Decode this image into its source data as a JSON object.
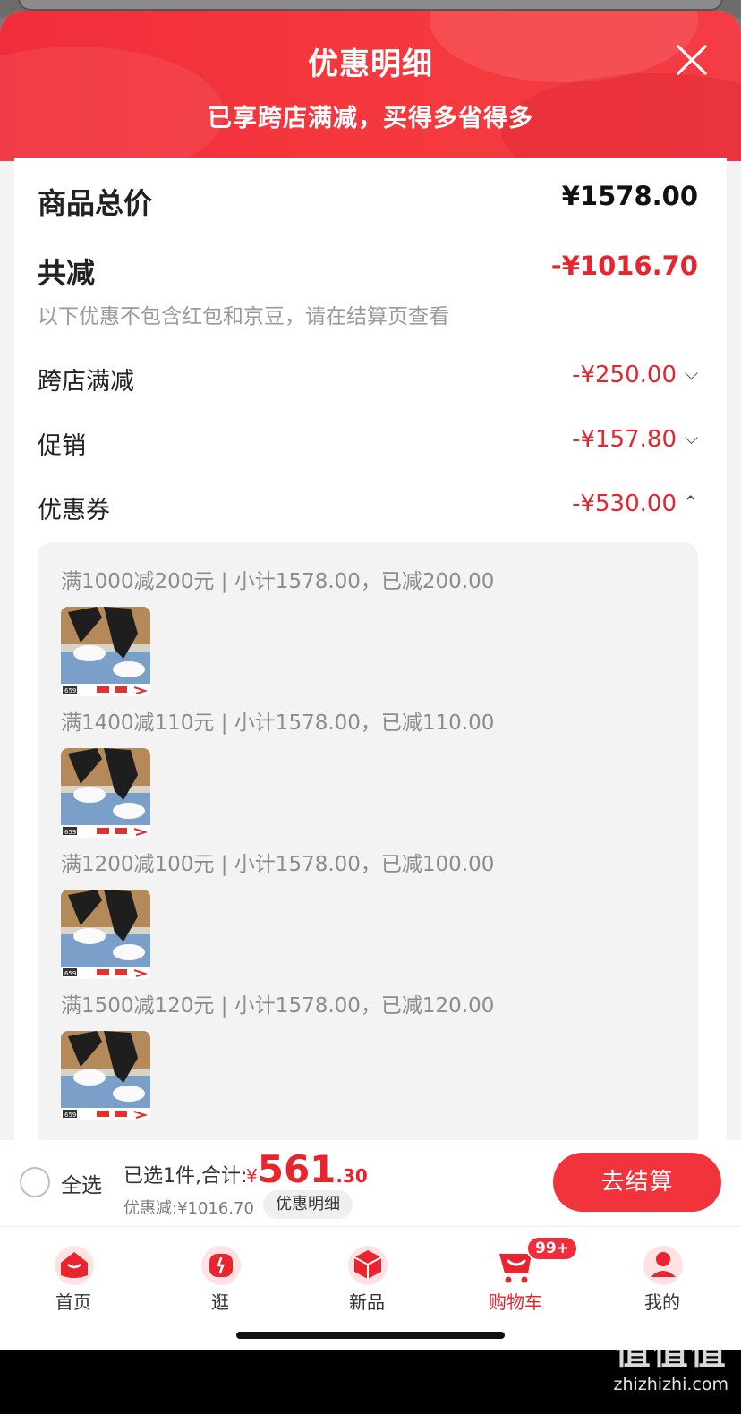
{
  "sheet": {
    "title": "优惠明细",
    "subtitle": "已享跨店满减，买得多省得多"
  },
  "summary": {
    "total_label": "商品总价",
    "total_value": "¥1578.00",
    "reduce_label": "共减",
    "reduce_value": "-¥1016.70",
    "note": "以下优惠不包含红包和京豆，请在结算页查看"
  },
  "discounts": [
    {
      "label": "跨店满减",
      "value": "-¥250.00",
      "expanded": false
    },
    {
      "label": "促销",
      "value": "-¥157.80",
      "expanded": false
    },
    {
      "label": "优惠券",
      "value": "-¥530.00",
      "expanded": true
    }
  ],
  "coupons": [
    {
      "text": "满1000减200元 | 小计1578.00，已减200.00",
      "thumb_label": "659"
    },
    {
      "text": "满1400减110元 | 小计1578.00，已减110.00",
      "thumb_label": "659"
    },
    {
      "text": "满1200减100元 | 小计1578.00，已减100.00",
      "thumb_label": "659"
    },
    {
      "text": "满1500减120元 | 小计1578.00，已减120.00",
      "thumb_label": "659"
    }
  ],
  "checkout_bar": {
    "select_all": "全选",
    "selected_text": "已选1件,合计:",
    "currency": "¥",
    "price_int": "561",
    "price_dec": ".30",
    "discount_text": "优惠减:¥1016.70",
    "detail_button": "优惠明细",
    "checkout_button": "去结算"
  },
  "tabbar": {
    "items": [
      {
        "label": "首页",
        "icon": "home-icon"
      },
      {
        "label": "逛",
        "icon": "browse-icon"
      },
      {
        "label": "新品",
        "icon": "new-products-icon"
      },
      {
        "label": "购物车",
        "icon": "cart-icon",
        "active": true,
        "badge": "99+"
      },
      {
        "label": "我的",
        "icon": "profile-icon"
      }
    ]
  },
  "watermark": {
    "logo": "值值值",
    "url": "zhizhizhi.com"
  },
  "colors": {
    "brand_red": "#f12d3b",
    "discount_red": "#e8242f"
  }
}
